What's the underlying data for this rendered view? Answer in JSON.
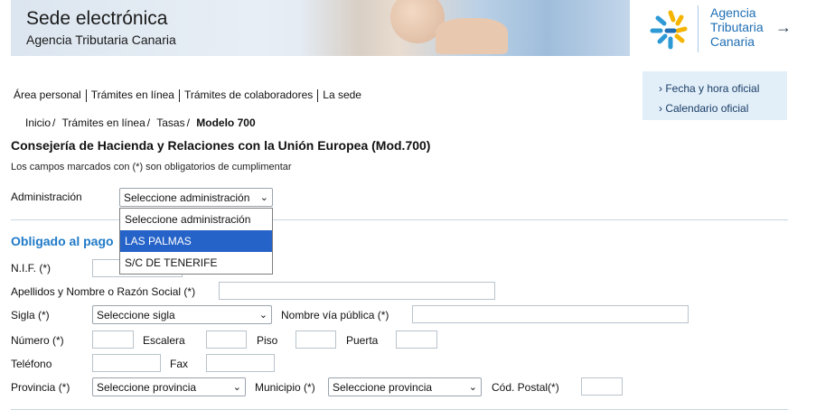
{
  "header": {
    "title": "Sede electrónica",
    "subtitle": "Agencia Tributaria Canaria",
    "logo_lines": [
      "Agencia",
      "Tributaria",
      "Canaria"
    ]
  },
  "topnav": [
    "Área personal",
    "Trámites en línea",
    "Trámites de colaboradores",
    "La sede"
  ],
  "sidebox": [
    "Fecha y hora oficial",
    "Calendario oficial"
  ],
  "breadcrumb": [
    "Inicio",
    "Trámites en línea",
    "Tasas",
    "Modelo 700"
  ],
  "page": {
    "title": "Consejería de Hacienda y Relaciones con la Unión Europea (Mod.700)",
    "note": "Los campos marcados con (*) son obligatorios de cumplimentar"
  },
  "admin": {
    "label": "Administración",
    "selected": "Seleccione administración",
    "options": [
      "Seleccione administración",
      "LAS PALMAS",
      "S/C DE TENERIFE"
    ],
    "highlighted_index": 1
  },
  "section": {
    "title": "Obligado al pago"
  },
  "fields": {
    "nif": "N.I.F. (*)",
    "apellidos": "Apellidos y Nombre o Razón Social (*)",
    "sigla": "Sigla (*)",
    "sigla_selected": "Seleccione sigla",
    "via": "Nombre vía pública (*)",
    "numero": "Número (*)",
    "escalera": "Escalera",
    "piso": "Piso",
    "puerta": "Puerta",
    "telefono": "Teléfono",
    "fax": "Fax",
    "provincia": "Provincia (*)",
    "provincia_selected": "Seleccione provincia",
    "municipio": "Municipio (*)",
    "municipio_selected": "Seleccione provincia",
    "cp": "Cód. Postal(*)"
  },
  "colors": {
    "accent": "#1f7ac8",
    "highlight": "#2563c8",
    "sidebox_bg": "#e2eff9"
  }
}
